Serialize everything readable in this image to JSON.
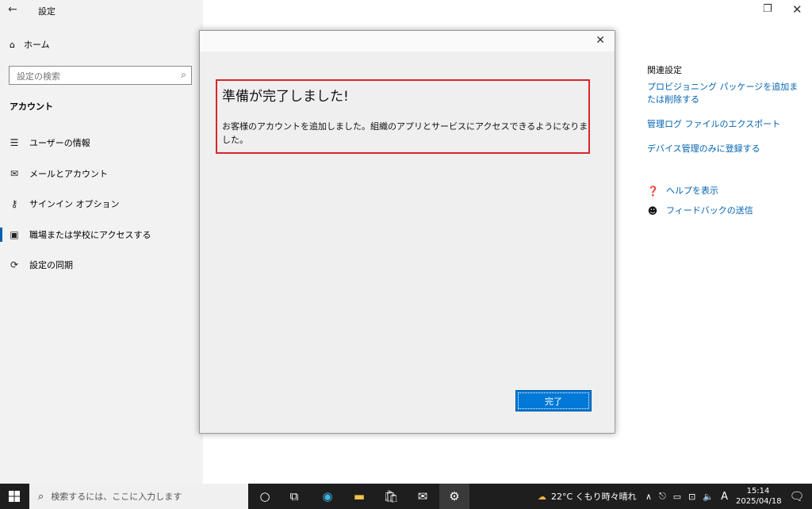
{
  "window": {
    "title": "設定",
    "back_icon": "arrow-left-icon",
    "restore_icon": "restore-icon",
    "close_icon": "close-icon"
  },
  "sidebar": {
    "home_label": "ホーム",
    "search_placeholder": "設定の検索",
    "section_title": "アカウント",
    "items": [
      {
        "label": "ユーザーの情報",
        "icon": "user-info-icon"
      },
      {
        "label": "メールとアカウント",
        "icon": "mail-icon"
      },
      {
        "label": "サインイン オプション",
        "icon": "key-icon"
      },
      {
        "label": "職場または学校にアクセスする",
        "icon": "briefcase-icon",
        "active": true
      },
      {
        "label": "設定の同期",
        "icon": "sync-icon"
      }
    ]
  },
  "related": {
    "title": "関連設定",
    "links": [
      "プロビジョニング パッケージを追加または削除する",
      "管理ログ ファイルのエクスポート",
      "デバイス管理のみに登録する"
    ],
    "help_label": "ヘルプを表示",
    "feedback_label": "フィードバックの送信"
  },
  "dialog": {
    "heading": "準備が完了しました!",
    "message": "お客様のアカウントを追加しました。組織のアプリとサービスにアクセスできるようになりました。",
    "done_button": "完了",
    "highlight_color": "#d9262c"
  },
  "taskbar": {
    "search_placeholder": "検索するには、ここに入力します",
    "apps": [
      "cortana-icon",
      "task-view-icon",
      "edge-icon",
      "file-explorer-icon",
      "store-icon",
      "mail-icon",
      "settings-icon"
    ],
    "weather": "22°C くもり時々晴れ",
    "ime": "A",
    "time": "15:14",
    "date": "2025/04/18"
  }
}
